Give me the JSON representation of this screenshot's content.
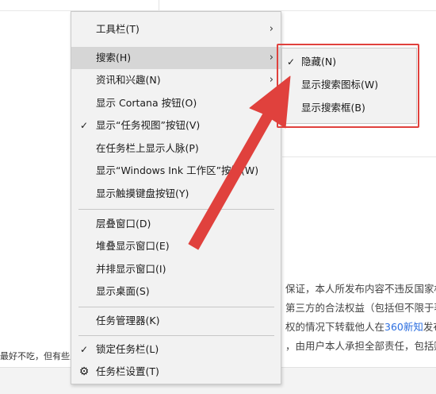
{
  "context_menu": {
    "items": [
      {
        "label": "工具栏(T)",
        "check": "",
        "chevron": "›"
      },
      {
        "label": "搜索(H)",
        "check": "",
        "chevron": "›"
      },
      {
        "label": "资讯和兴趣(N)",
        "check": "",
        "chevron": "›"
      },
      {
        "label": "显示 Cortana 按钮(O)",
        "check": "",
        "chevron": ""
      },
      {
        "label": "显示“任务视图”按钮(V)",
        "check": "✓",
        "chevron": ""
      },
      {
        "label": "在任务栏上显示人脉(P)",
        "check": "",
        "chevron": ""
      },
      {
        "label": "显示“Windows Ink 工作区”按钮(W)",
        "check": "",
        "chevron": ""
      },
      {
        "label": "显示触摸键盘按钮(Y)",
        "check": "",
        "chevron": ""
      },
      {
        "label": "层叠窗口(D)",
        "check": "",
        "chevron": ""
      },
      {
        "label": "堆叠显示窗口(E)",
        "check": "",
        "chevron": ""
      },
      {
        "label": "并排显示窗口(I)",
        "check": "",
        "chevron": ""
      },
      {
        "label": "显示桌面(S)",
        "check": "",
        "chevron": ""
      },
      {
        "label": "任务管理器(K)",
        "check": "",
        "chevron": ""
      },
      {
        "label": "锁定任务栏(L)",
        "check": "✓",
        "chevron": ""
      },
      {
        "label": "任务栏设置(T)",
        "check": "",
        "chevron": ""
      }
    ],
    "settings_icon": "gear-icon"
  },
  "search_submenu": {
    "items": [
      {
        "label": "隐藏(N)",
        "check": "✓"
      },
      {
        "label": "显示搜索图标(W)",
        "check": ""
      },
      {
        "label": "显示搜索框(B)",
        "check": ""
      }
    ]
  },
  "background": {
    "para_1": "保证，本人所发布内容不违反国家相关",
    "para_2": "第三方的合法权益（包括但不限于著作",
    "para_3_prefix": "权的情况下转载他人在",
    "para_3_link": "360新知",
    "para_3_suffix": "发布的",
    "para_4": "，由用户本人承担全部责任，包括赔偿",
    "left_line": "最好不吃，但有些人"
  },
  "colors": {
    "annotation_red": "#e0413d",
    "menu_bg": "#f2f2f2",
    "highlight": "#d6d6d6"
  }
}
